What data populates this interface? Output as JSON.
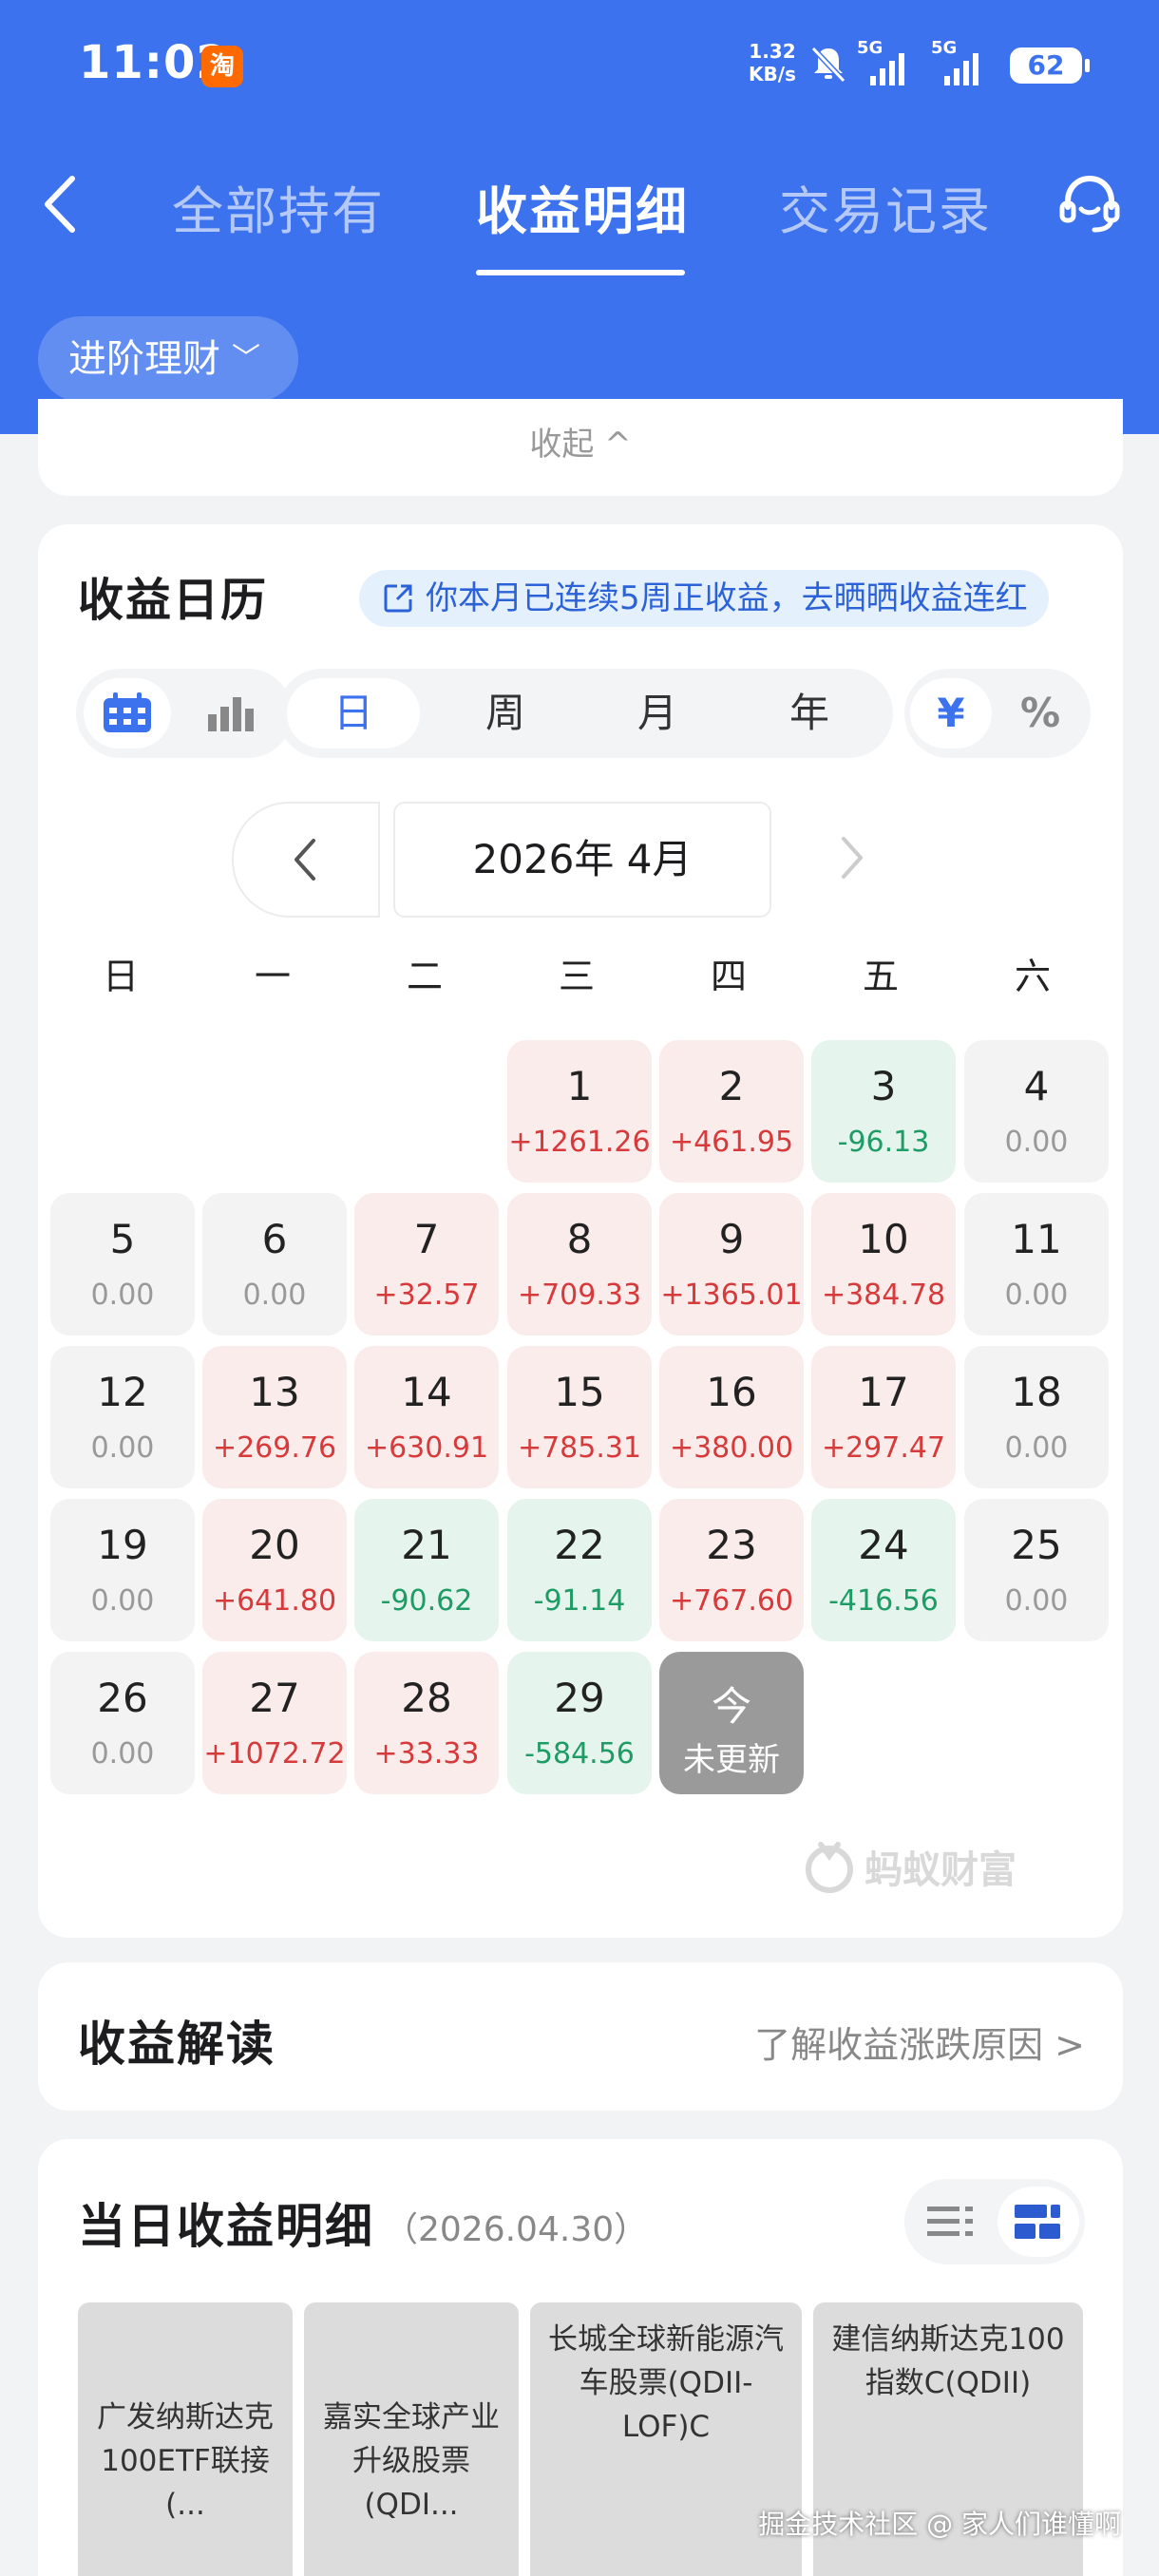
{
  "status_bar": {
    "time": "11:02",
    "net_speed_value": "1.32",
    "net_speed_unit": "KB/s",
    "sim1": "5G",
    "sim2": "5G",
    "battery": "62"
  },
  "nav": {
    "tabs": [
      "全部持有",
      "收益明细",
      "交易记录"
    ],
    "active_tab": 1
  },
  "product_selector": "进阶理财",
  "collapse_label": "收起 ^",
  "calendar": {
    "title": "收益日历",
    "streak_text": "你本月已连续5周正收益，去晒晒收益连红",
    "periods": [
      "日",
      "周",
      "月",
      "年"
    ],
    "active_period": 0,
    "units": [
      "¥",
      "%"
    ],
    "active_unit": 0,
    "month_label": "2026年 4月",
    "weekdays": [
      "日",
      "一",
      "二",
      "三",
      "四",
      "五",
      "六"
    ],
    "days": [
      {
        "day": "1",
        "value": "+1261.26",
        "type": "pos"
      },
      {
        "day": "2",
        "value": "+461.95",
        "type": "pos"
      },
      {
        "day": "3",
        "value": "-96.13",
        "type": "neg"
      },
      {
        "day": "4",
        "value": "0.00",
        "type": "zero"
      },
      {
        "day": "5",
        "value": "0.00",
        "type": "zero"
      },
      {
        "day": "6",
        "value": "0.00",
        "type": "zero"
      },
      {
        "day": "7",
        "value": "+32.57",
        "type": "pos"
      },
      {
        "day": "8",
        "value": "+709.33",
        "type": "pos"
      },
      {
        "day": "9",
        "value": "+1365.01",
        "type": "pos"
      },
      {
        "day": "10",
        "value": "+384.78",
        "type": "pos"
      },
      {
        "day": "11",
        "value": "0.00",
        "type": "zero"
      },
      {
        "day": "12",
        "value": "0.00",
        "type": "zero"
      },
      {
        "day": "13",
        "value": "+269.76",
        "type": "pos"
      },
      {
        "day": "14",
        "value": "+630.91",
        "type": "pos"
      },
      {
        "day": "15",
        "value": "+785.31",
        "type": "pos"
      },
      {
        "day": "16",
        "value": "+380.00",
        "type": "pos"
      },
      {
        "day": "17",
        "value": "+297.47",
        "type": "pos"
      },
      {
        "day": "18",
        "value": "0.00",
        "type": "zero"
      },
      {
        "day": "19",
        "value": "0.00",
        "type": "zero"
      },
      {
        "day": "20",
        "value": "+641.80",
        "type": "pos"
      },
      {
        "day": "21",
        "value": "-90.62",
        "type": "neg"
      },
      {
        "day": "22",
        "value": "-91.14",
        "type": "neg"
      },
      {
        "day": "23",
        "value": "+767.60",
        "type": "pos"
      },
      {
        "day": "24",
        "value": "-416.56",
        "type": "neg"
      },
      {
        "day": "25",
        "value": "0.00",
        "type": "zero"
      },
      {
        "day": "26",
        "value": "0.00",
        "type": "zero"
      },
      {
        "day": "27",
        "value": "+1072.72",
        "type": "pos"
      },
      {
        "day": "28",
        "value": "+33.33",
        "type": "pos"
      },
      {
        "day": "29",
        "value": "-584.56",
        "type": "neg"
      },
      {
        "day": "今",
        "value": "未更新",
        "type": "today"
      }
    ],
    "brand": "蚂蚁财富"
  },
  "interpretation": {
    "title": "收益解读",
    "link": "了解收益涨跌原因 >"
  },
  "detail": {
    "title": "当日收益明细",
    "date": "（2026.04.30）",
    "funds": [
      "广发纳斯达克100ETF联接(...",
      "嘉实全球产业升级股票(QDI...",
      "长城全球新能源汽车股票(QDII-LOF)C",
      "建信纳斯达克100指数C(QDII)"
    ]
  },
  "watermark": "掘金技术社区 @ 家人们谁懂啊",
  "colors": {
    "brand_blue": "#3d72ee",
    "gain_red": "#d63a3a",
    "loss_green": "#1f9c66"
  }
}
